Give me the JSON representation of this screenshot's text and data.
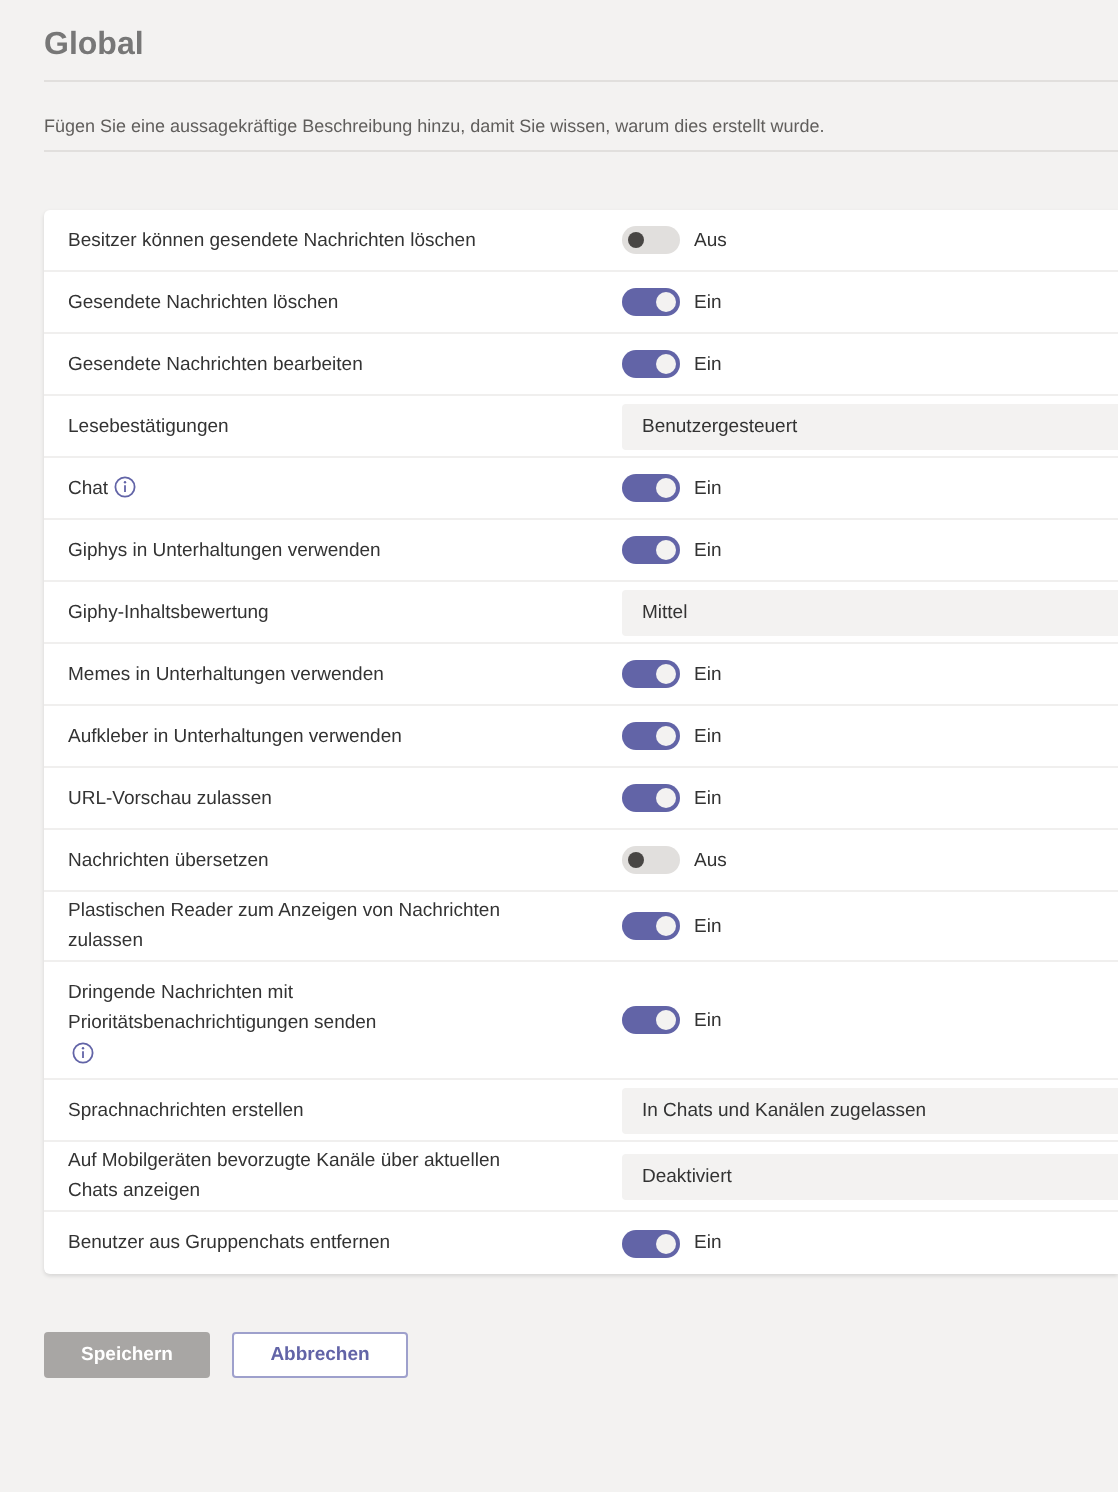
{
  "title": "Global",
  "description": "Fügen Sie eine aussagekräftige Beschreibung hinzu, damit Sie wissen, warum dies erstellt wurde.",
  "settings": [
    {
      "label": "Besitzer können gesendete Nachrichten löschen",
      "info_icon": false,
      "kind": "toggle",
      "on": false,
      "state_text": "Aus"
    },
    {
      "label": "Gesendete Nachrichten löschen",
      "info_icon": false,
      "kind": "toggle",
      "on": true,
      "state_text": "Ein"
    },
    {
      "label": "Gesendete Nachrichten bearbeiten",
      "info_icon": false,
      "kind": "toggle",
      "on": true,
      "state_text": "Ein"
    },
    {
      "label": "Lesebestätigungen",
      "info_icon": false,
      "kind": "dropdown",
      "value": "Benutzergesteuert"
    },
    {
      "label": "Chat",
      "info_icon": true,
      "kind": "toggle",
      "on": true,
      "state_text": "Ein"
    },
    {
      "label": "Giphys in Unterhaltungen verwenden",
      "info_icon": false,
      "kind": "toggle",
      "on": true,
      "state_text": "Ein"
    },
    {
      "label": "Giphy-Inhaltsbewertung",
      "info_icon": false,
      "kind": "dropdown",
      "value": "Mittel"
    },
    {
      "label": "Memes in Unterhaltungen verwenden",
      "info_icon": false,
      "kind": "toggle",
      "on": true,
      "state_text": "Ein"
    },
    {
      "label": "Aufkleber in Unterhaltungen verwenden",
      "info_icon": false,
      "kind": "toggle",
      "on": true,
      "state_text": "Ein"
    },
    {
      "label": "URL-Vorschau zulassen",
      "info_icon": false,
      "kind": "toggle",
      "on": true,
      "state_text": "Ein"
    },
    {
      "label": "Nachrichten übersetzen",
      "info_icon": false,
      "kind": "toggle",
      "on": false,
      "state_text": "Aus"
    },
    {
      "label": "Plastischen Reader zum Anzeigen von Nachrichten zulassen",
      "info_icon": false,
      "kind": "toggle",
      "on": true,
      "state_text": "Ein"
    },
    {
      "label": "Dringende Nachrichten mit Prioritätsbenachrichtigungen senden",
      "info_icon": true,
      "kind": "toggle",
      "on": true,
      "state_text": "Ein"
    },
    {
      "label": "Sprachnachrichten erstellen",
      "info_icon": false,
      "kind": "dropdown",
      "value": "In Chats und Kanälen zugelassen"
    },
    {
      "label": "Auf Mobilgeräten bevorzugte Kanäle über aktuellen Chats anzeigen",
      "info_icon": false,
      "kind": "dropdown",
      "value": "Deaktiviert"
    },
    {
      "label": "Benutzer aus Gruppenchats entfernen",
      "info_icon": false,
      "kind": "toggle",
      "on": true,
      "state_text": "Ein"
    }
  ],
  "buttons": [
    {
      "label": "Speichern",
      "kind": "primary",
      "disabled": true
    },
    {
      "label": "Abbrechen",
      "kind": "secondary",
      "disabled": false
    }
  ]
}
